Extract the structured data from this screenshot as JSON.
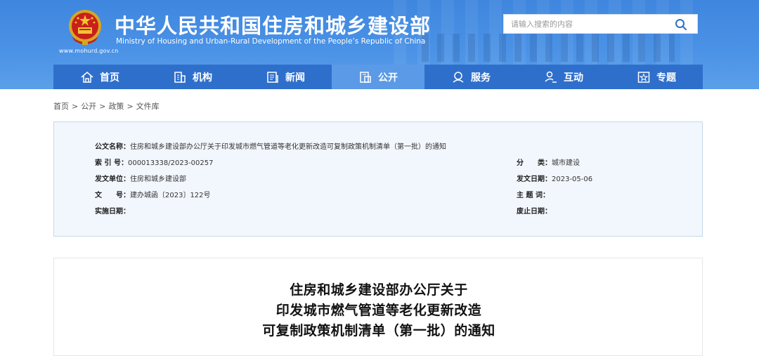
{
  "header": {
    "title_cn": "中华人民共和国住房和城乡建设部",
    "title_en": "Ministry of Housing and Urban-Rural Development of the People’s Republic of China",
    "url": "www.mohurd.gov.cn",
    "search_placeholder": "请输入搜索的内容",
    "colors": {
      "header_bg": "#4a92e6",
      "nav_bg": "#2f6fcc",
      "nav_active": "#5b9ae6"
    }
  },
  "nav": {
    "items": [
      {
        "label": "首页",
        "icon": "home-icon"
      },
      {
        "label": "机构",
        "icon": "building-icon"
      },
      {
        "label": "新闻",
        "icon": "news-icon"
      },
      {
        "label": "公开",
        "icon": "document-icon",
        "active": true
      },
      {
        "label": "服务",
        "icon": "service-icon"
      },
      {
        "label": "互动",
        "icon": "interaction-icon"
      },
      {
        "label": "专题",
        "icon": "star-icon"
      }
    ]
  },
  "breadcrumb": [
    "首页",
    "公开",
    "政策",
    "文件库"
  ],
  "info": {
    "name_key": "公文名称：",
    "name_val": "住房和城乡建设部办公厅关于印发城市燃气管道等老化更新改造可复制政策机制清单（第一批）的通知",
    "index_key": "索 引 号：",
    "index_val": "000013338/2023-00257",
    "category_key": "分　　类：",
    "category_val": "城市建设",
    "issuer_key": "发文单位：",
    "issuer_val": "住房和城乡建设部",
    "date_key": "发文日期：",
    "date_val": "2023-05-06",
    "docno_key": "文　　号：",
    "docno_val": "建办城函〔2023〕122号",
    "subject_key": "主 题 词：",
    "subject_val": "",
    "impl_key": "实施日期：",
    "impl_val": "",
    "expire_key": "废止日期：",
    "expire_val": ""
  },
  "article": {
    "title_lines": [
      "住房和城乡建设部办公厅关于",
      "印发城市燃气管道等老化更新改造",
      "可复制政策机制清单（第一批）的通知"
    ]
  }
}
